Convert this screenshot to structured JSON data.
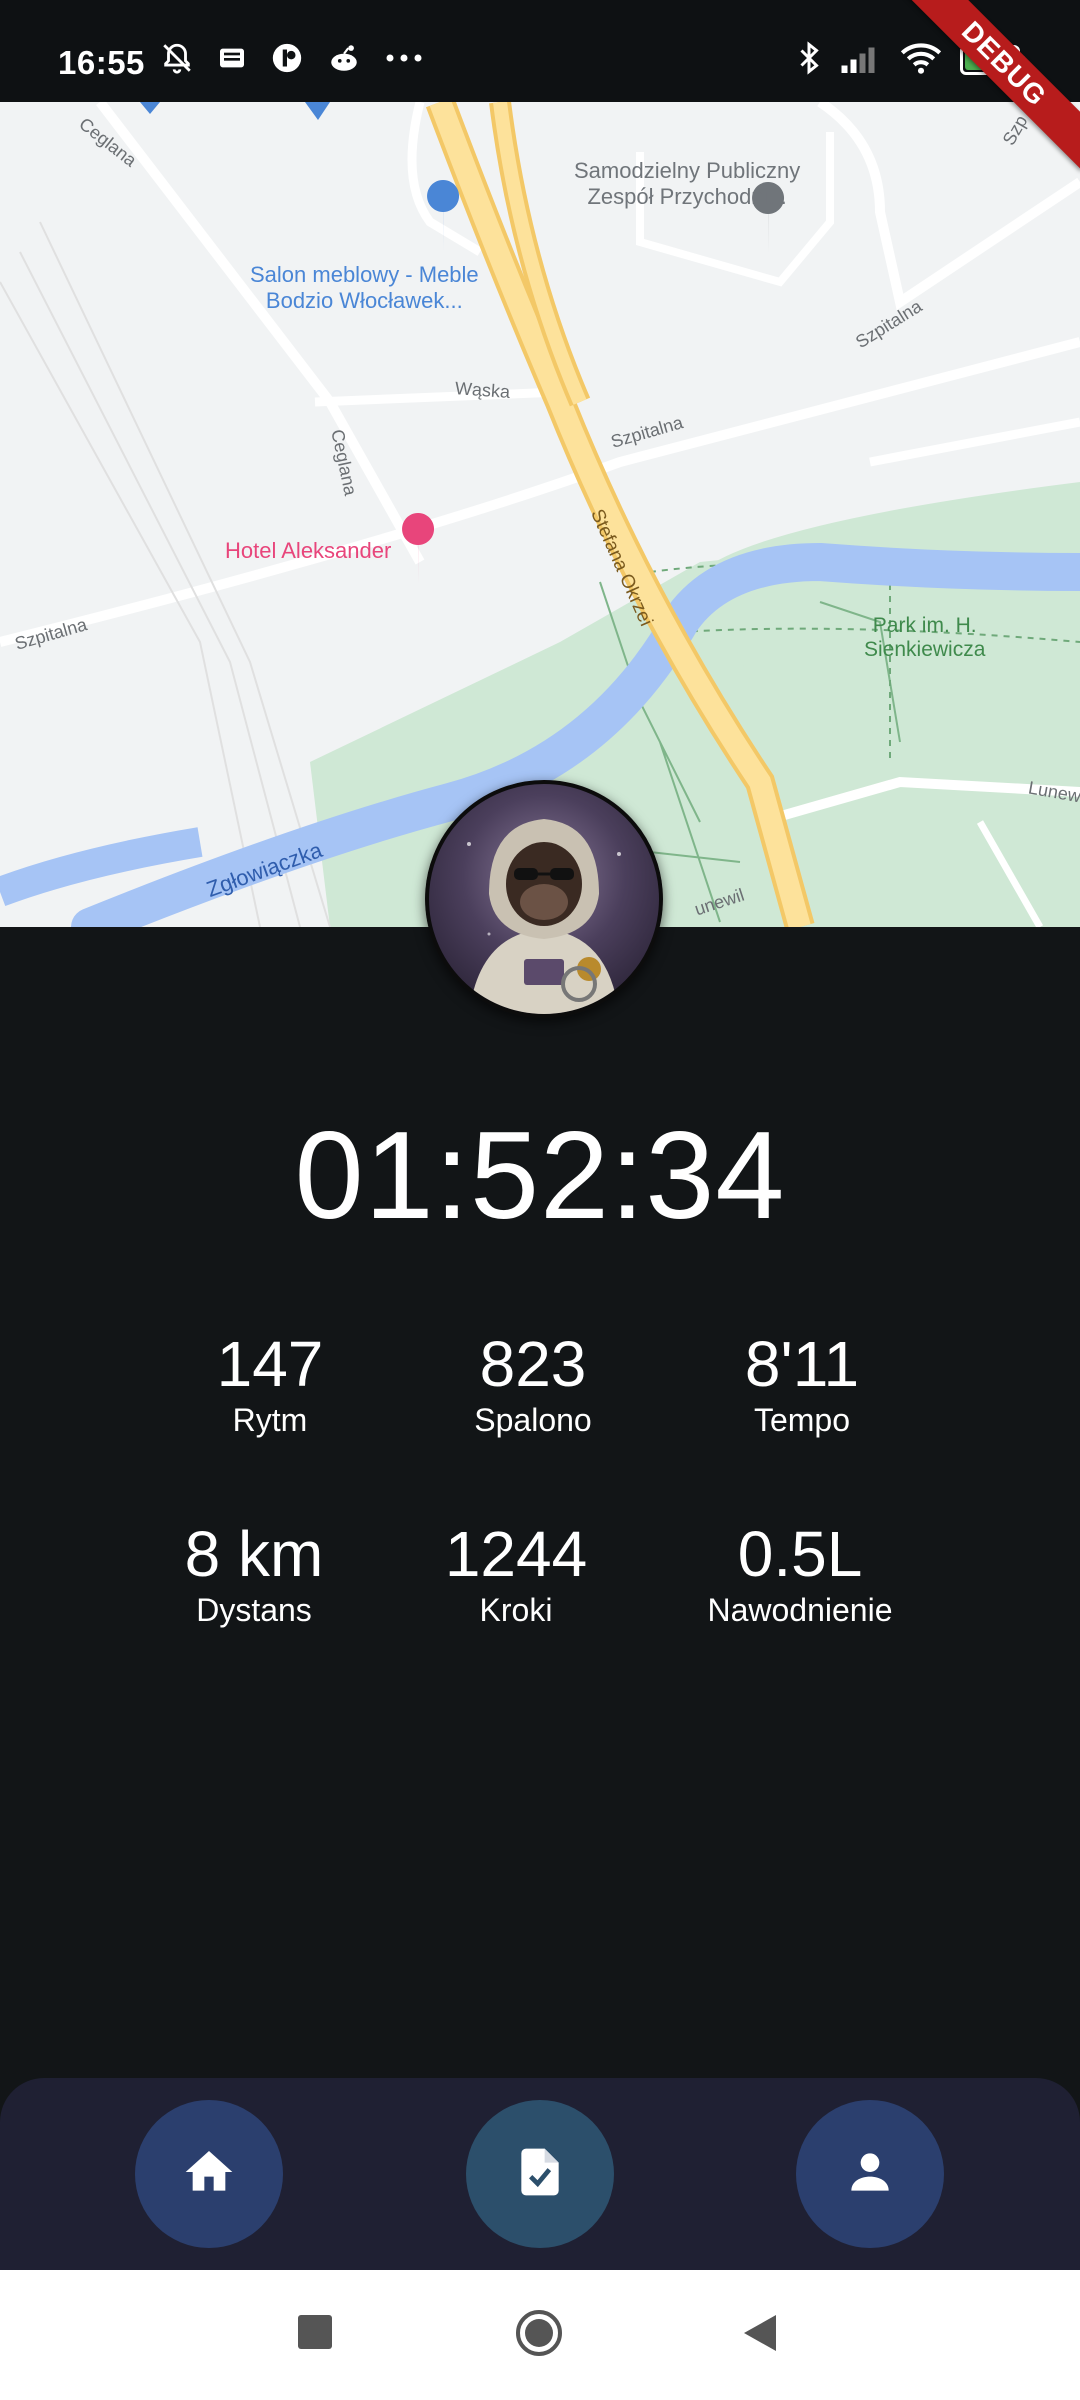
{
  "status_bar": {
    "time": "16:55",
    "battery_level": "92",
    "left_icons": [
      "notifications-off-icon",
      "news-icon",
      "app-icon",
      "reddit-icon",
      "more-icon"
    ],
    "right_icons": [
      "bluetooth-icon",
      "signal-icon",
      "wifi-icon",
      "battery-icon"
    ]
  },
  "debug_banner": "DEBUG",
  "map": {
    "streets": {
      "ceglana_top": "Ceglana",
      "ceglana_mid": "Ceglana",
      "waska": "Wąska",
      "szpitalna_left": "Szpitalna",
      "szpitalna_mid": "Szpitalna",
      "szpitalna_right": "Szpitalna",
      "stefana_okrzei": "Stefana Okrzei",
      "lunewil_right": "Lunew",
      "lunewil_bottom": "unewil",
      "szp_corner": "Szp"
    },
    "pois": {
      "clinic_line1": "Samodzielny Publiczny",
      "clinic_line2": "Zespół Przychodni...",
      "furniture_line1": "Salon meblowy - Meble",
      "furniture_line2": "Bodzio Włocławek...",
      "hotel": "Hotel Aleksander",
      "park_line1": "Park im. H.",
      "park_line2": "Sienkiewicza",
      "river": "Zgłowiączka"
    }
  },
  "timer": "01:52:34",
  "stats": [
    {
      "value": "147",
      "label": "Rytm"
    },
    {
      "value": "823",
      "label": "Spalono"
    },
    {
      "value": "8'11",
      "label": "Tempo"
    },
    {
      "value": "8 km",
      "label": "Dystans"
    },
    {
      "value": "1244",
      "label": "Kroki"
    },
    {
      "value": "0.5L",
      "label": "Nawodnienie"
    }
  ],
  "bottom_nav": {
    "items": [
      {
        "icon": "home-icon",
        "color": "#2b3f6e"
      },
      {
        "icon": "task-document-icon",
        "color": "#2c4f6b"
      },
      {
        "icon": "person-icon",
        "color": "#2b3f6e"
      }
    ]
  },
  "system_nav": {
    "icons": [
      "recent-apps-icon",
      "home-circle-icon",
      "back-icon"
    ]
  },
  "colors": {
    "background": "#121517",
    "nav_background": "#1f2033",
    "debug": "#b71c1c",
    "battery": "#4caf50"
  }
}
